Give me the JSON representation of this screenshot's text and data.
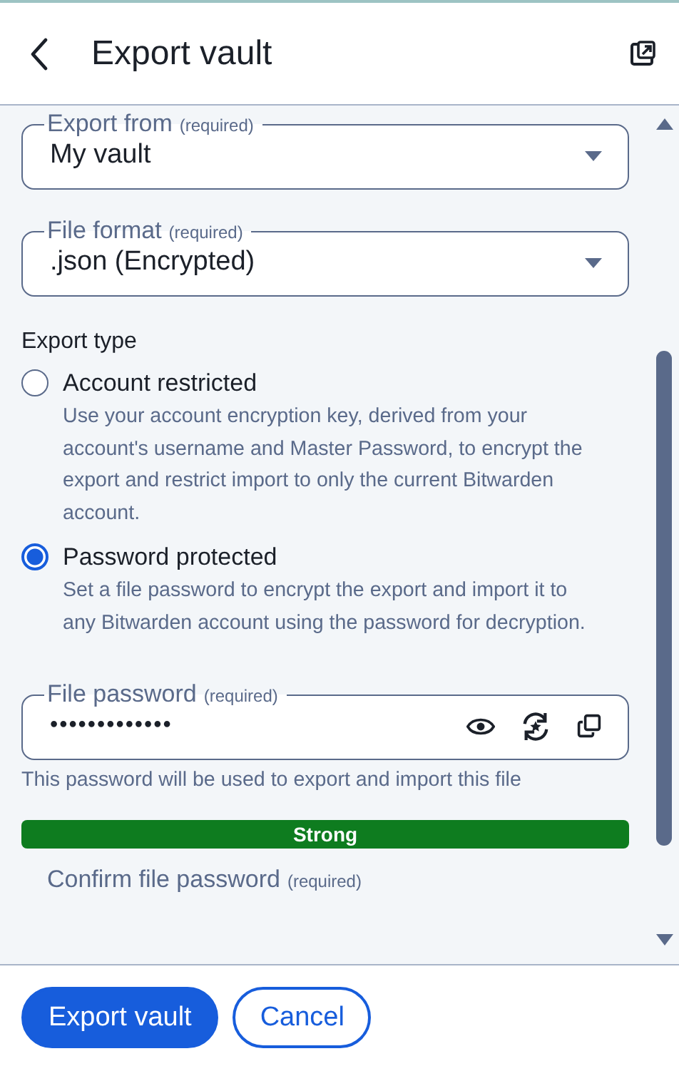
{
  "header": {
    "title": "Export vault"
  },
  "fields": [
    {
      "kind": "select",
      "label": "Export from",
      "required_note": "(required)",
      "value": "My vault"
    },
    {
      "kind": "select",
      "label": "File format",
      "required_note": "(required)",
      "value": ".json (Encrypted)"
    }
  ],
  "export_type": {
    "heading": "Export type",
    "options": [
      {
        "label": "Account restricted",
        "description": "Use your account encryption key, derived from your account's username and Master Password, to encrypt the export and restrict import to only the current Bitwarden account.",
        "selected": false
      },
      {
        "label": "Password protected",
        "description": "Set a file password to encrypt the export and import it to any Bitwarden account using the password for decryption.",
        "selected": true
      }
    ]
  },
  "password_field": {
    "label": "File password",
    "required_note": "(required)",
    "value": "•••••••••••••",
    "hint": "This password will be used to export and import this file"
  },
  "strength": {
    "label": "Strong",
    "level": 1,
    "color": "#0e7c1f"
  },
  "confirm_field": {
    "label": "Confirm file password",
    "required_note": "(required)"
  },
  "buttons": [
    {
      "label": "Export vault",
      "kind": "primary"
    },
    {
      "label": "Cancel",
      "kind": "secondary"
    }
  ]
}
